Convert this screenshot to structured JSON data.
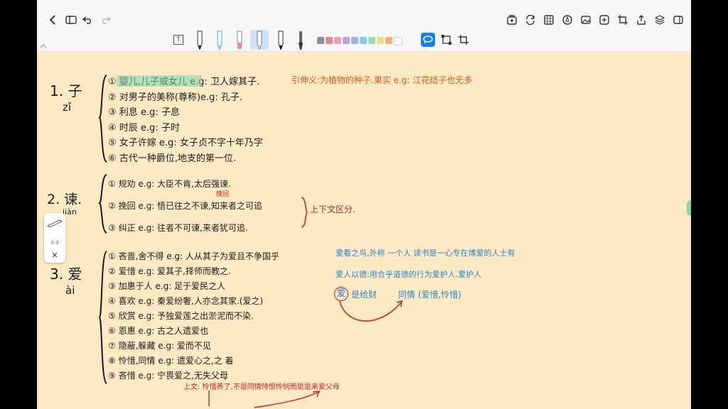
{
  "toolbar": {
    "icons_left": [
      "back-icon",
      "sidebar-icon",
      "undo-icon",
      "redo-icon"
    ],
    "icons_right": [
      "add-page-icon",
      "rotate-icon",
      "grid-icon",
      "pen-circle-icon",
      "image-icon",
      "sticker-icon",
      "crop-icon",
      "share-icon",
      "layers-icon",
      "reader-icon"
    ],
    "text_tool_label": "T",
    "swatches": [
      "#8a8f99",
      "#e58b8b",
      "#e8a1b8",
      "#b9a1e0",
      "#9fb3e6",
      "#86cde2",
      "#9edcb6",
      "#eedb8c",
      "#f3b07b",
      "#ffffff"
    ],
    "accent": "#1a7fe6"
  },
  "side_panel": {
    "size_label": "0.3",
    "close_label": "×"
  },
  "notes": {
    "s1_num": "1. 子",
    "s1_pinyin": "zǐ",
    "s1_items": [
      "① 婴儿,儿子或女儿 e.g: 卫人嫁其子.",
      "② 对男子的美称(尊称)e.g: 孔子.",
      "③ 利息 e.g: 子息",
      "④ 时辰 e.g: 子时",
      "⑤ 女子许嫁 e.g: 女子贞不字十年乃字",
      "⑥ 古代一种爵位,地支的第一位."
    ],
    "s1_orange": "引伸义:为植物的种子.果实 e.g: 江花结子也无多",
    "s2_num": "2. 谏.",
    "s2_pinyin": "jiàn",
    "s2_items": [
      "① 规劝 e.g: 大臣不肯,太后强谏.",
      "② 挽回 e.g: 悟已往之不谏,知来者之可追",
      "③ 纠正 e.g: 往者不可谏,来者犹可追."
    ],
    "s2_small": "挽回",
    "s2_right": "上下文区分.",
    "s3_num": "3. 爱",
    "s3_pinyin": "ài",
    "s3_items": [
      "① 吝啬,舍不得 e.g: 人从其子为爱且不争国乎",
      "② 爱惜 e.g: 爱其子,择师而教之.",
      "③ 加惠于人 e.g: 足于爱民之人",
      "④ 喜欢 e.g: 秦爱纷奢,人亦念其家.(爱之)",
      "⑤ 欣赏 e.g: 予独爱莲之出淤泥而不染.",
      "⑥ 恩惠 e.g: 古之人遗爱也",
      "⑦ 隐蔽,躲藏 e.g: 爱而不见",
      "⑧ 怜惜,同情 e.g: 遗爱心之,之 着",
      "⑨ 吝惜 e.g: 宁畏爱之,无失父母"
    ],
    "s3_blue1": "爱看之鸟,外称 一个人 读书是一心专在博爱的人士有",
    "s3_blue2": "爱人以德:用合乎道德的行为爱护人.爱护人",
    "s3_blue3_circ": "爱",
    "s3_blue3_a": "是给财",
    "s3_blue3_b": "同情 (爱惜,怜惜)",
    "s3_bottom": "上文: 怜惜养了,不是同情恃恨怜悯而是是来爱父母"
  }
}
